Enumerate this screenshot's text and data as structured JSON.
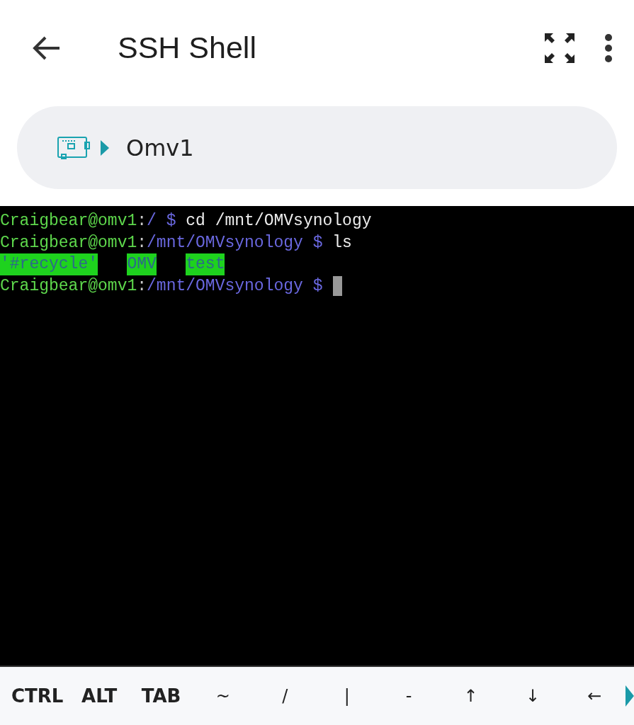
{
  "app_bar": {
    "title": "SSH Shell"
  },
  "breadcrumb": {
    "host": "Omv1"
  },
  "terminal": {
    "cursor": true,
    "lines": [
      [
        {
          "kind": "user",
          "text": "Craigbear@omv1"
        },
        {
          "kind": "plain",
          "text": ":"
        },
        {
          "kind": "path",
          "text": "/ $"
        },
        {
          "kind": "cmd",
          "text": " cd /mnt/OMVsynology"
        }
      ],
      [
        {
          "kind": "user",
          "text": "Craigbear@omv1"
        },
        {
          "kind": "plain",
          "text": ":"
        },
        {
          "kind": "path",
          "text": "/mnt/OMVsynology $"
        },
        {
          "kind": "cmd",
          "text": " ls"
        }
      ],
      [
        {
          "kind": "dir",
          "text": "'#recycle'"
        },
        {
          "kind": "dir",
          "text": "OMV"
        },
        {
          "kind": "dir",
          "text": "test"
        }
      ],
      [
        {
          "kind": "user",
          "text": "Craigbear@omv1"
        },
        {
          "kind": "plain",
          "text": ":"
        },
        {
          "kind": "path",
          "text": "/mnt/OMVsynology $"
        }
      ]
    ]
  },
  "keys": [
    {
      "label": "CTRL",
      "kind": "word"
    },
    {
      "label": "ALT",
      "kind": "word"
    },
    {
      "label": "TAB",
      "kind": "word"
    },
    {
      "label": "~",
      "kind": "symbol"
    },
    {
      "label": "/",
      "kind": "symbol"
    },
    {
      "label": "|",
      "kind": "symbol"
    },
    {
      "label": "-",
      "kind": "symbol"
    },
    {
      "label": "↑",
      "kind": "symbol"
    },
    {
      "label": "↓",
      "kind": "symbol"
    },
    {
      "label": "←",
      "kind": "symbol"
    }
  ]
}
